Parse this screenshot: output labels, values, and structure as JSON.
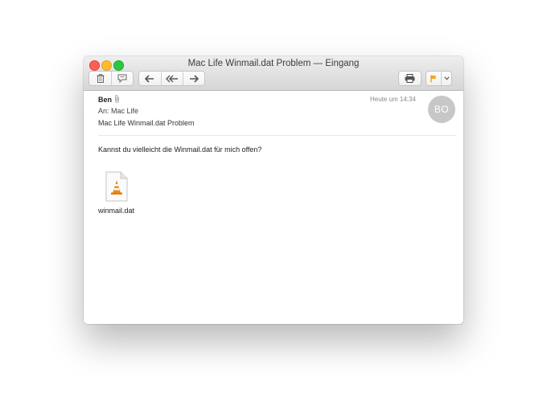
{
  "window": {
    "title": "Mac Life Winmail.dat Problem — Eingang"
  },
  "toolbar": {
    "icons": [
      "trash-icon",
      "junk-icon",
      "reply-icon",
      "reply-all-icon",
      "forward-icon",
      "print-icon",
      "flag-icon",
      "chevron-down-icon"
    ],
    "flag_color": "#f5a623"
  },
  "message": {
    "sender": "Ben",
    "to_label": "An:",
    "to": "Mac Life",
    "subject": "Mac Life Winmail.dat Problem",
    "date": "Heute um 14:34",
    "avatar_initials": "BO",
    "body": "Kannst du vielleicht die Winmail.dat für mich offen?"
  },
  "attachment": {
    "filename": "winmail.dat",
    "icon": "vlc-cone-file-icon"
  },
  "colors": {
    "close": "#fc5f57",
    "minimize": "#fdbc2e",
    "maximize": "#28c840",
    "avatar": "#c7c7c7"
  }
}
